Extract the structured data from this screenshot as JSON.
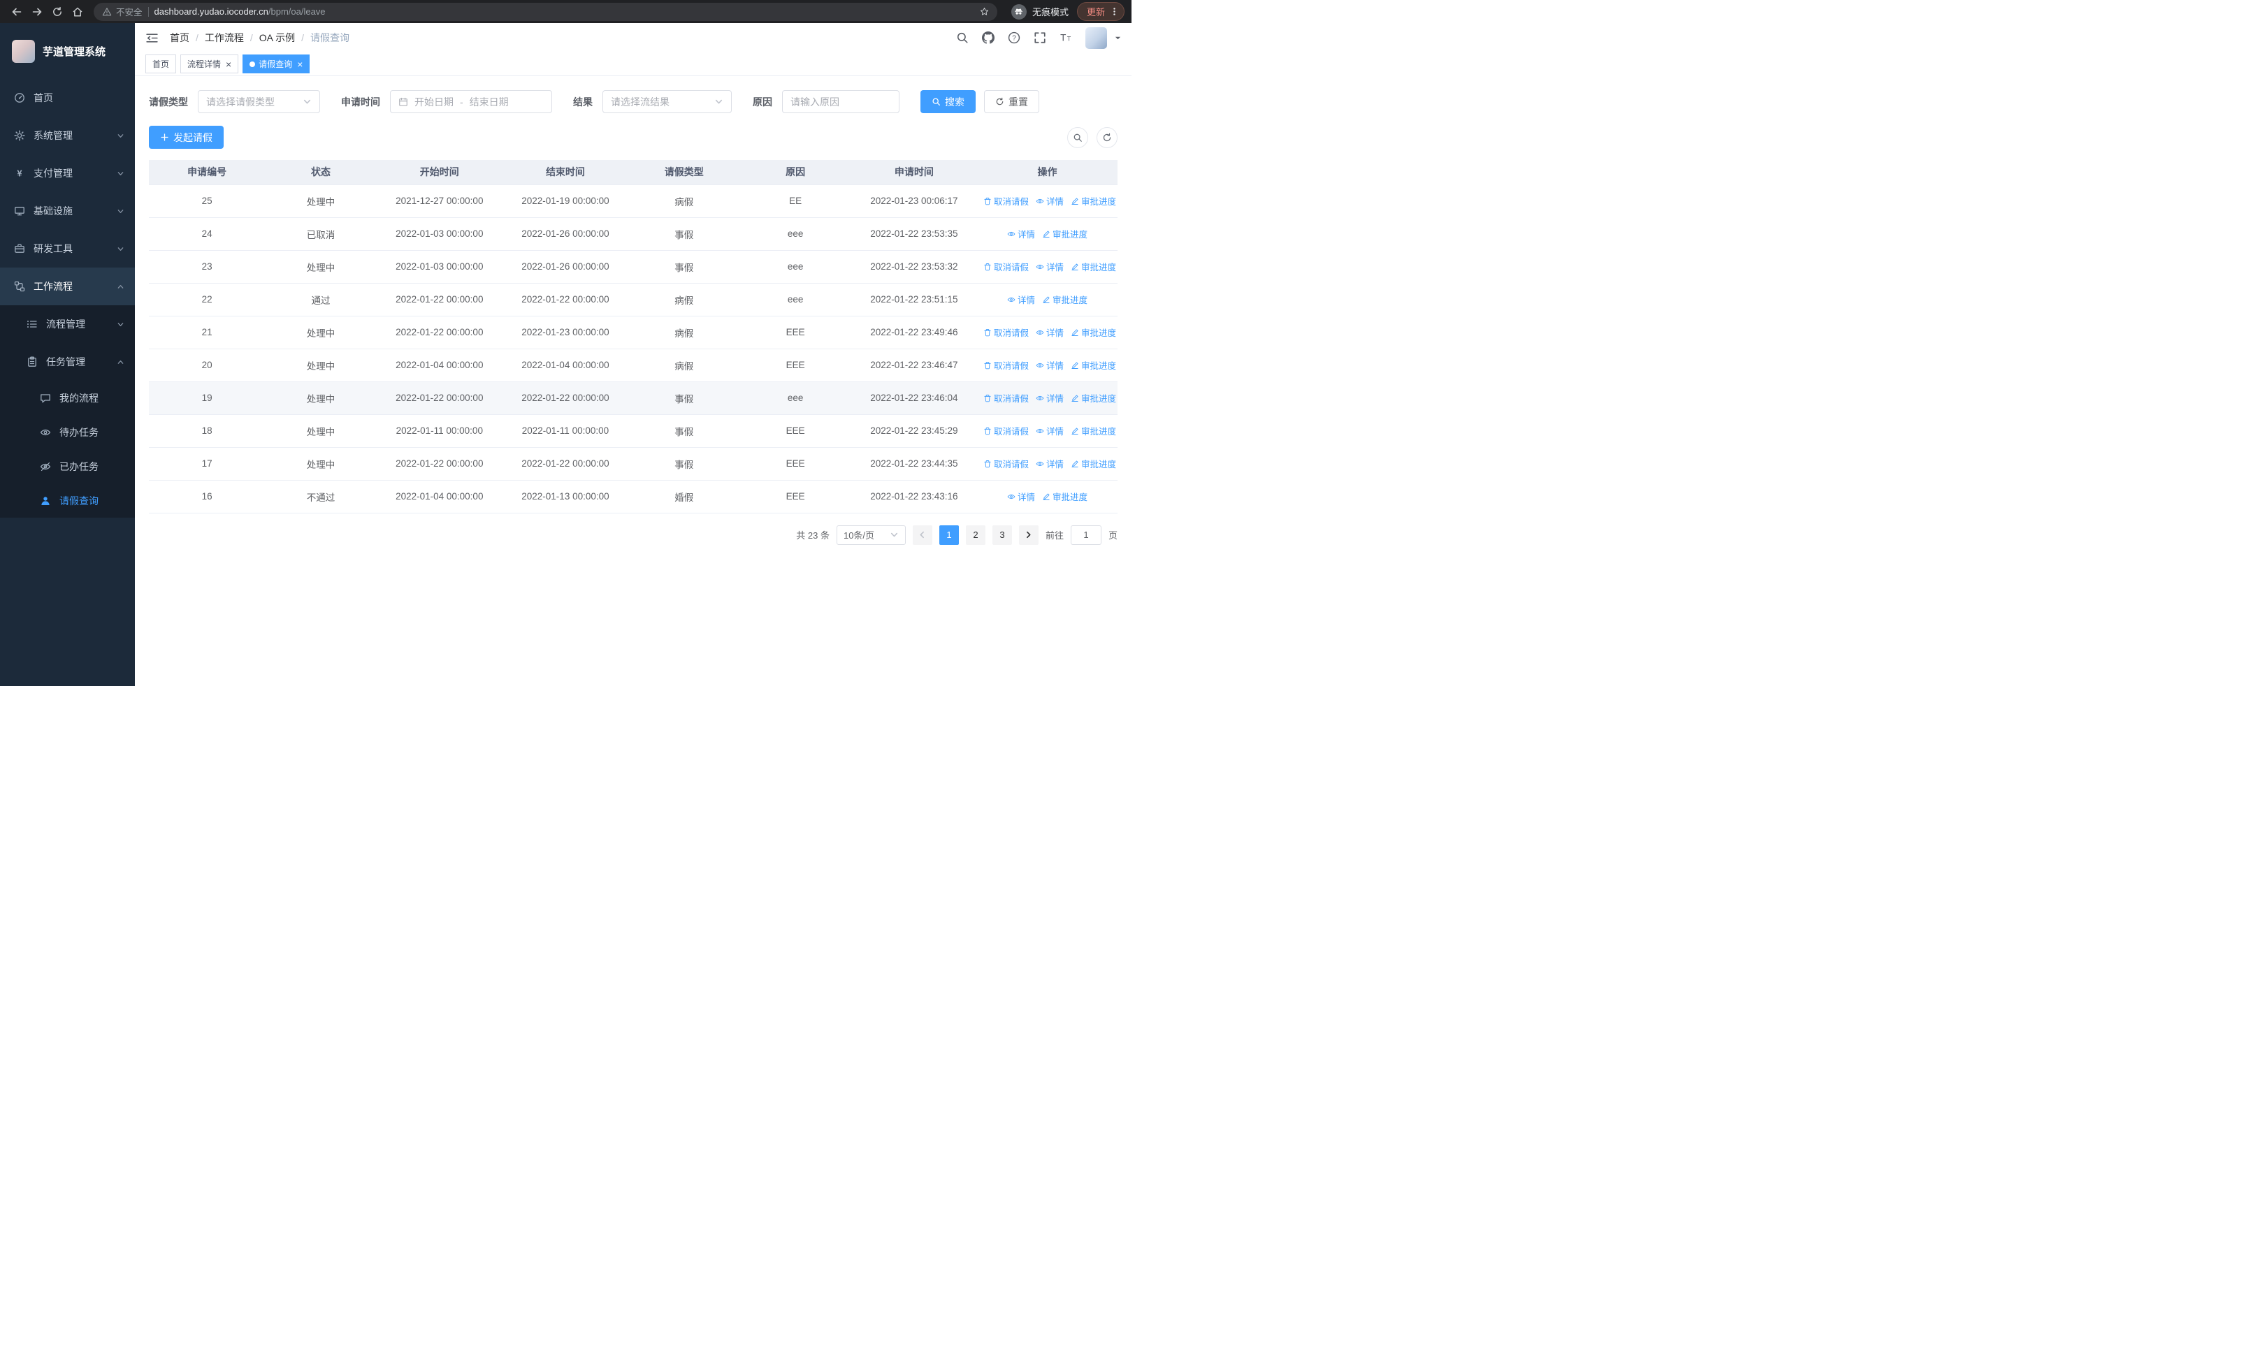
{
  "browser": {
    "security_label": "不安全",
    "url_domain": "dashboard.yudao.iocoder.cn",
    "url_path": "/bpm/oa/leave",
    "incognito_label": "无痕模式",
    "update_label": "更新"
  },
  "sidebar": {
    "app_title": "芋道管理系统",
    "menu": [
      {
        "label": "首页",
        "icon": "dashboard-icon",
        "level": 1
      },
      {
        "label": "系统管理",
        "icon": "gear-icon",
        "level": 1,
        "arrow": "down"
      },
      {
        "label": "支付管理",
        "icon": "yen-icon",
        "level": 1,
        "arrow": "down"
      },
      {
        "label": "基础设施",
        "icon": "monitor-icon",
        "level": 1,
        "arrow": "down"
      },
      {
        "label": "研发工具",
        "icon": "briefcase-icon",
        "level": 1,
        "arrow": "down"
      },
      {
        "label": "工作流程",
        "icon": "workflow-icon",
        "level": 1,
        "arrow": "up",
        "open": true
      },
      {
        "label": "流程管理",
        "icon": "list-icon",
        "level": 2,
        "arrow": "down"
      },
      {
        "label": "任务管理",
        "icon": "clipboard-icon",
        "level": 2,
        "arrow": "up"
      },
      {
        "label": "我的流程",
        "icon": "chat-icon",
        "level": 3
      },
      {
        "label": "待办任务",
        "icon": "eye-icon",
        "level": 3
      },
      {
        "label": "已办任务",
        "icon": "eye-off-icon",
        "level": 3
      },
      {
        "label": "请假查询",
        "icon": "user-icon",
        "level": 3,
        "active": true
      }
    ]
  },
  "navbar": {
    "breadcrumb": [
      "首页",
      "工作流程",
      "OA 示例",
      "请假查询"
    ]
  },
  "tabs": [
    {
      "label": "首页",
      "closable": false,
      "active": false
    },
    {
      "label": "流程详情",
      "closable": true,
      "active": false
    },
    {
      "label": "请假查询",
      "closable": true,
      "active": true
    }
  ],
  "filters": {
    "leave_type_label": "请假类型",
    "leave_type_placeholder": "请选择请假类型",
    "apply_time_label": "申请时间",
    "start_date_placeholder": "开始日期",
    "date_separator": "-",
    "end_date_placeholder": "结束日期",
    "result_label": "结果",
    "result_placeholder": "请选择流结果",
    "reason_label": "原因",
    "reason_placeholder": "请输入原因",
    "search_button": "搜索",
    "reset_button": "重置"
  },
  "toolbar": {
    "create_button": "发起请假"
  },
  "table": {
    "columns": [
      "申请编号",
      "状态",
      "开始时间",
      "结束时间",
      "请假类型",
      "原因",
      "申请时间",
      "操作"
    ],
    "action_defs": {
      "cancel": {
        "label": "取消请假",
        "icon": "trash-icon",
        "name": "cancel-leave-link"
      },
      "detail": {
        "label": "详情",
        "icon": "view-icon",
        "name": "detail-link"
      },
      "progress": {
        "label": "审批进度",
        "icon": "edit-icon",
        "name": "approval-progress-link"
      }
    },
    "rows": [
      {
        "id": "25",
        "status": "处理中",
        "start": "2021-12-27 00:00:00",
        "end": "2022-01-19 00:00:00",
        "type": "病假",
        "reason": "EE",
        "applied": "2022-01-23 00:06:17",
        "actions": [
          "cancel",
          "detail",
          "progress"
        ],
        "highlighted": false
      },
      {
        "id": "24",
        "status": "已取消",
        "start": "2022-01-03 00:00:00",
        "end": "2022-01-26 00:00:00",
        "type": "事假",
        "reason": "eee",
        "applied": "2022-01-22 23:53:35",
        "actions": [
          "detail",
          "progress"
        ],
        "highlighted": false
      },
      {
        "id": "23",
        "status": "处理中",
        "start": "2022-01-03 00:00:00",
        "end": "2022-01-26 00:00:00",
        "type": "事假",
        "reason": "eee",
        "applied": "2022-01-22 23:53:32",
        "actions": [
          "cancel",
          "detail",
          "progress"
        ],
        "highlighted": false
      },
      {
        "id": "22",
        "status": "通过",
        "start": "2022-01-22 00:00:00",
        "end": "2022-01-22 00:00:00",
        "type": "病假",
        "reason": "eee",
        "applied": "2022-01-22 23:51:15",
        "actions": [
          "detail",
          "progress"
        ],
        "highlighted": false
      },
      {
        "id": "21",
        "status": "处理中",
        "start": "2022-01-22 00:00:00",
        "end": "2022-01-23 00:00:00",
        "type": "病假",
        "reason": "EEE",
        "applied": "2022-01-22 23:49:46",
        "actions": [
          "cancel",
          "detail",
          "progress"
        ],
        "highlighted": false
      },
      {
        "id": "20",
        "status": "处理中",
        "start": "2022-01-04 00:00:00",
        "end": "2022-01-04 00:00:00",
        "type": "病假",
        "reason": "EEE",
        "applied": "2022-01-22 23:46:47",
        "actions": [
          "cancel",
          "detail",
          "progress"
        ],
        "highlighted": false
      },
      {
        "id": "19",
        "status": "处理中",
        "start": "2022-01-22 00:00:00",
        "end": "2022-01-22 00:00:00",
        "type": "事假",
        "reason": "eee",
        "applied": "2022-01-22 23:46:04",
        "actions": [
          "cancel",
          "detail",
          "progress"
        ],
        "highlighted": true
      },
      {
        "id": "18",
        "status": "处理中",
        "start": "2022-01-11 00:00:00",
        "end": "2022-01-11 00:00:00",
        "type": "事假",
        "reason": "EEE",
        "applied": "2022-01-22 23:45:29",
        "actions": [
          "cancel",
          "detail",
          "progress"
        ],
        "highlighted": false
      },
      {
        "id": "17",
        "status": "处理中",
        "start": "2022-01-22 00:00:00",
        "end": "2022-01-22 00:00:00",
        "type": "事假",
        "reason": "EEE",
        "applied": "2022-01-22 23:44:35",
        "actions": [
          "cancel",
          "detail",
          "progress"
        ],
        "highlighted": false
      },
      {
        "id": "16",
        "status": "不通过",
        "start": "2022-01-04 00:00:00",
        "end": "2022-01-13 00:00:00",
        "type": "婚假",
        "reason": "EEE",
        "applied": "2022-01-22 23:43:16",
        "actions": [
          "detail",
          "progress"
        ],
        "highlighted": false
      }
    ]
  },
  "pagination": {
    "total": "共 23 条",
    "page_size": "10条/页",
    "pages": [
      "1",
      "2",
      "3"
    ],
    "active_page": "1",
    "goto_label": "前往",
    "goto_value": "1",
    "goto_suffix": "页"
  },
  "colors": {
    "primary": "#409eff",
    "sidebar_bg": "#1c2a3a",
    "sidebar_sub_bg": "#161f2b",
    "table_header_bg": "#eef1f6"
  }
}
